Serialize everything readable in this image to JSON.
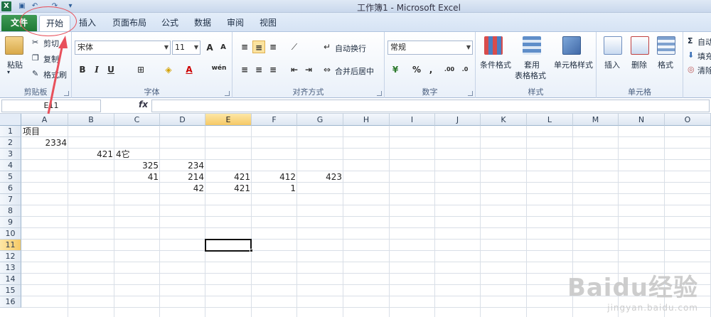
{
  "window": {
    "title": "工作簿1 - Microsoft Excel",
    "qat_icons": [
      "save-icon",
      "undo-icon",
      "redo-icon",
      "customize-icon"
    ]
  },
  "tabs": [
    {
      "key": "file",
      "label": "文件"
    },
    {
      "key": "home",
      "label": "开始"
    },
    {
      "key": "insert",
      "label": "插入"
    },
    {
      "key": "layout",
      "label": "页面布局"
    },
    {
      "key": "formula",
      "label": "公式"
    },
    {
      "key": "data",
      "label": "数据"
    },
    {
      "key": "review",
      "label": "审阅"
    },
    {
      "key": "view",
      "label": "视图"
    }
  ],
  "ribbon": {
    "clipboard": {
      "label": "剪贴板",
      "paste": "粘贴",
      "cut": "剪切",
      "copy": "复制",
      "format_painter": "格式刷"
    },
    "font": {
      "label": "字体",
      "font_name": "宋体",
      "font_size": "11",
      "bold": "B",
      "italic": "I",
      "underline": "U",
      "grow": "A",
      "shrink": "A",
      "font_color": "A",
      "phonetic": "wén"
    },
    "alignment": {
      "label": "对齐方式",
      "wrap": "自动换行",
      "merge": "合并后居中"
    },
    "number": {
      "label": "数字",
      "format": "常规",
      "percent": "%",
      "comma": ","
    },
    "styles": {
      "label": "样式",
      "cond": "条件格式",
      "table_1": "套用",
      "table_2": "表格格式",
      "cell_styles": "单元格样式"
    },
    "cells": {
      "label": "单元格",
      "insert": "插入",
      "delete": "删除",
      "format": "格式"
    },
    "editing": {
      "autosum": "自动",
      "fill": "填充",
      "clear": "清除"
    }
  },
  "formula_bar": {
    "name_box": "E11",
    "fx": "fx",
    "content": ""
  },
  "columns": [
    "A",
    "B",
    "C",
    "D",
    "E",
    "F",
    "G",
    "H",
    "I",
    "J",
    "K",
    "L",
    "M",
    "N",
    "O"
  ],
  "rows": [
    "1",
    "2",
    "3",
    "4",
    "5",
    "6",
    "7",
    "8",
    "9",
    "10",
    "11",
    "12",
    "13",
    "14",
    "15",
    "16"
  ],
  "selected_cell": "E11",
  "cells": {
    "A1": "项目",
    "A2": "2334",
    "B3": "421",
    "C3": "4它",
    "C4": "325",
    "D4": "234",
    "C5": "41",
    "D5": "214",
    "E5": "421",
    "F5": "412",
    "G5": "423",
    "D6": "42",
    "E6": "421",
    "F6": "1"
  },
  "watermark": {
    "brand": "Baidu经验",
    "url": "jingyan.baidu.com"
  }
}
